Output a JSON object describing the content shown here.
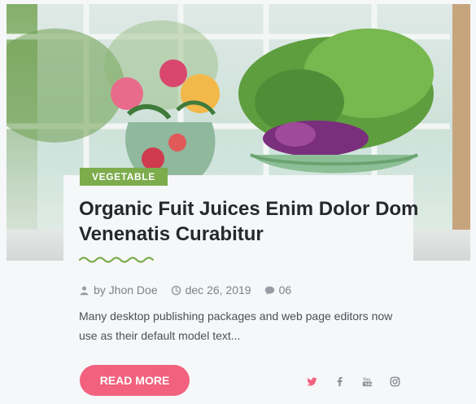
{
  "post": {
    "category": "VEGETABLE",
    "title": "Organic Fuit Juices Enim Dolor Dom Venenatis Curabitur",
    "author": "by Jhon Doe",
    "date": "dec 26, 2019",
    "comments": "06",
    "excerpt": "Many desktop publishing packages and web page editors now use as their default model text...",
    "read_more": "READ MORE"
  },
  "icons": {
    "author": "user-icon",
    "date": "clock-icon",
    "comments": "comment-icon",
    "social": [
      "twitter-icon",
      "facebook-icon",
      "youtube-icon",
      "instagram-icon"
    ]
  },
  "colors": {
    "accent": "#f2617e",
    "badge": "#7cac4c",
    "twitter": "#f2617e",
    "text_dark": "#26282c",
    "text_muted": "#7e8189"
  }
}
